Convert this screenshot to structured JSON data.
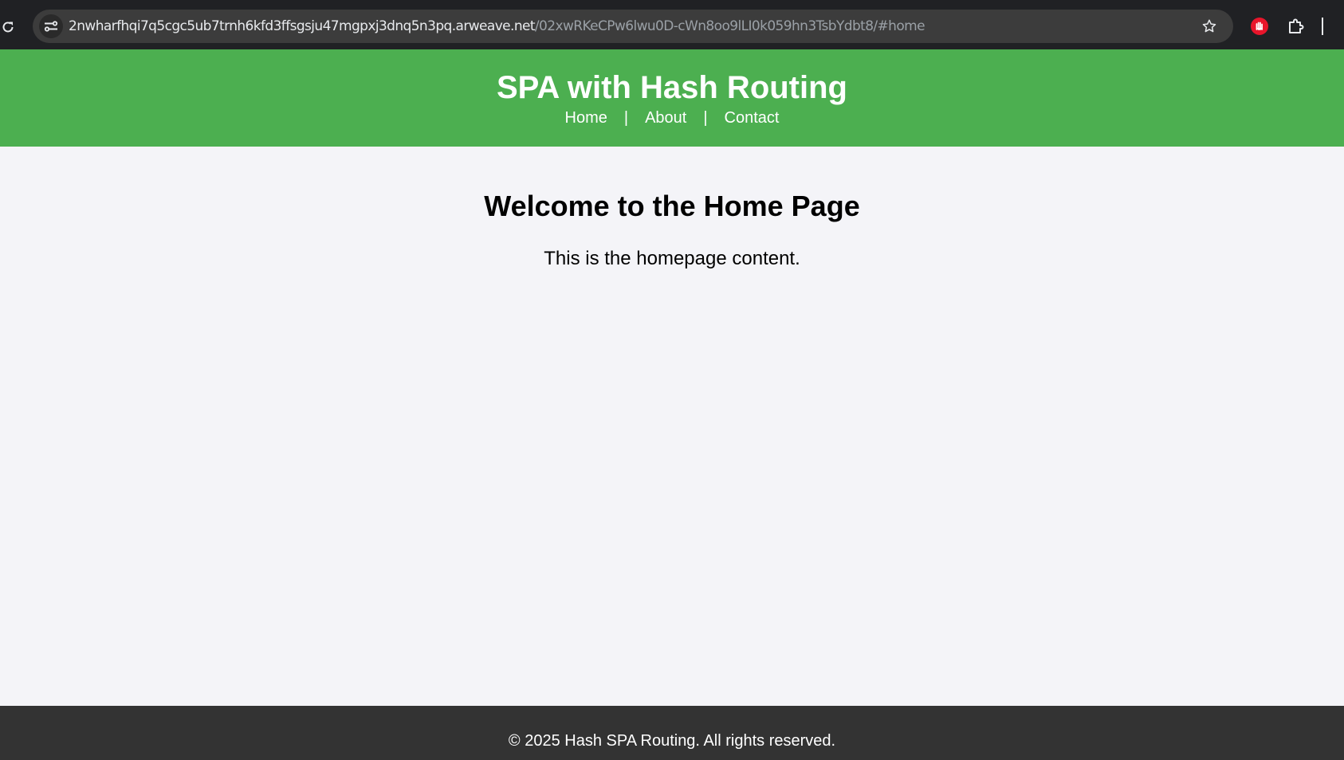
{
  "browser": {
    "url_host": "2nwharfhqi7q5cgc5ub7trnh6kfd3ffsgsju47mgpxj3dnq5n3pq.arweave.net",
    "url_path": "/02xwRKeCPw6lwu0D-cWn8oo9lLI0k059hn3TsbYdbt8/#home",
    "icons": [
      "reload-icon",
      "site-info-icon",
      "star-icon",
      "stop-extension-icon",
      "extensions-puzzle-icon"
    ]
  },
  "header": {
    "title": "SPA with Hash Routing",
    "nav": {
      "home": "Home",
      "about": "About",
      "contact": "Contact",
      "separator": "|"
    },
    "background": "#4caf50"
  },
  "main": {
    "heading": "Welcome to the Home Page",
    "text": "This is the homepage content."
  },
  "footer": {
    "text": "© 2025 Hash SPA Routing. All rights reserved.",
    "background": "#333333"
  }
}
